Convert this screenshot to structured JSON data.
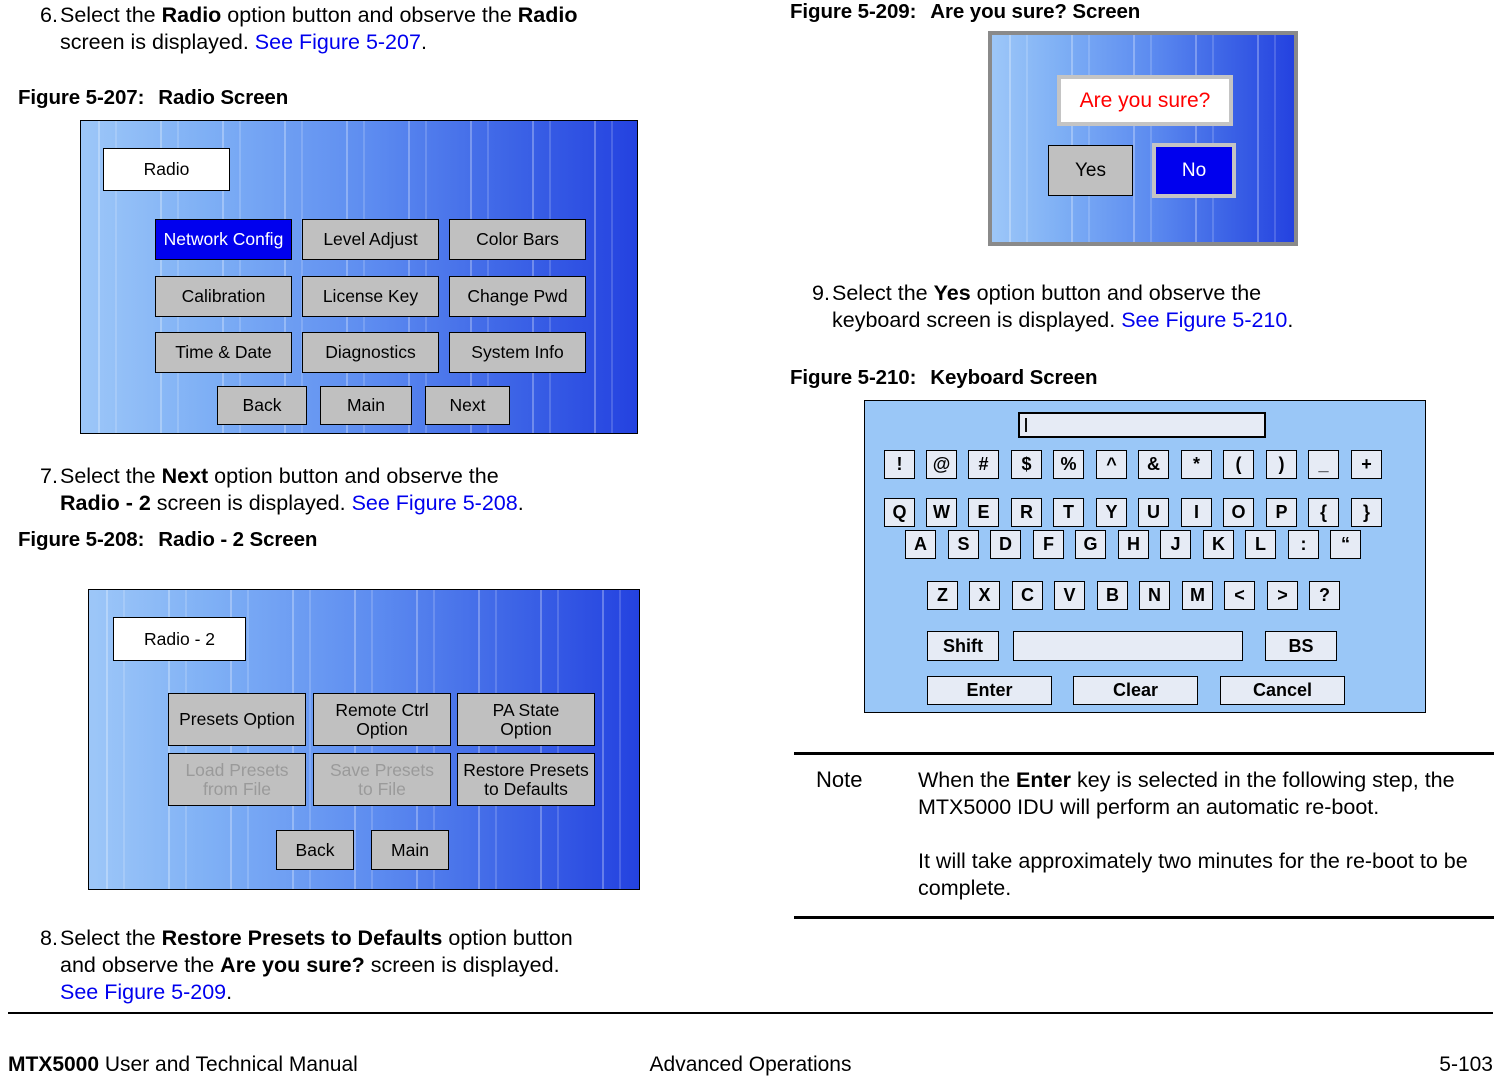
{
  "steps": {
    "s6": {
      "num": "6.",
      "l1_a": "Select the ",
      "l1_b": "Radio",
      "l1_c": " option button and observe the ",
      "l1_d": "Radio",
      "l2_a": "screen is displayed.  ",
      "l2_link": "See Figure 5-207",
      "l2_b": "."
    },
    "s7": {
      "num": "7.",
      "l1_a": "Select the ",
      "l1_b": "Next",
      "l1_c": " option button and observe the",
      "l2_a": "Radio - 2",
      "l2_b": " screen is displayed.  ",
      "l2_link": "See Figure 5-208",
      "l2_c": "."
    },
    "s8": {
      "num": "8.",
      "l1_a": "Select the ",
      "l1_b": "Restore Presets to Defaults",
      "l1_c": " option button",
      "l2_a": "and observe the ",
      "l2_b": "Are you sure?",
      "l2_c": " screen is displayed.",
      "l3_link": "See Figure 5-209",
      "l3_b": "."
    },
    "s9": {
      "num": "9.",
      "l1_a": "Select the ",
      "l1_b": "Yes",
      "l1_c": " option button and observe the",
      "l2_a": "keyboard screen is displayed.  ",
      "l2_link": "See Figure 5-210",
      "l2_b": "."
    }
  },
  "figures": {
    "f207": {
      "number": "Figure 5-207:",
      "title": "Radio Screen"
    },
    "f208": {
      "number": "Figure 5-208:",
      "title": "Radio - 2 Screen"
    },
    "f209": {
      "number": "Figure 5-209:",
      "title": "Are you sure? Screen"
    },
    "f210": {
      "number": "Figure 5-210:",
      "title": "Keyboard Screen"
    }
  },
  "radio_screen": {
    "title": "Radio",
    "buttons": [
      {
        "label": "Network Config",
        "state": "selected"
      },
      {
        "label": "Level Adjust",
        "state": "normal"
      },
      {
        "label": "Color Bars",
        "state": "normal"
      },
      {
        "label": "Calibration",
        "state": "normal"
      },
      {
        "label": "License Key",
        "state": "normal"
      },
      {
        "label": "Change Pwd",
        "state": "normal"
      },
      {
        "label": "Time & Date",
        "state": "normal"
      },
      {
        "label": "Diagnostics",
        "state": "normal"
      },
      {
        "label": "System Info",
        "state": "normal"
      }
    ],
    "nav": [
      {
        "label": "Back"
      },
      {
        "label": "Main"
      },
      {
        "label": "Next"
      }
    ]
  },
  "radio2_screen": {
    "title": "Radio - 2",
    "buttons": [
      {
        "label": "Presets Option",
        "state": "normal"
      },
      {
        "label": "Remote Ctrl\nOption",
        "state": "normal"
      },
      {
        "label": "PA State\nOption",
        "state": "normal"
      },
      {
        "label": "Load Presets\nfrom File",
        "state": "disabled"
      },
      {
        "label": "Save Presets\nto File",
        "state": "disabled"
      },
      {
        "label": "Restore Presets\nto Defaults",
        "state": "normal"
      }
    ],
    "nav": [
      {
        "label": "Back"
      },
      {
        "label": "Main"
      }
    ]
  },
  "confirm_screen": {
    "message": "Are you sure?",
    "message_color": "#ff0000",
    "yes_label": "Yes",
    "no_label": "No",
    "no_state": "selected"
  },
  "keyboard_screen": {
    "field_value": "",
    "rows": [
      {
        "keys": [
          "!",
          "@",
          "#",
          "$",
          "%",
          "^",
          "&",
          "*",
          "(",
          ")",
          "_",
          "+"
        ]
      },
      {
        "keys": [
          "Q",
          "W",
          "E",
          "R",
          "T",
          "Y",
          "U",
          "I",
          "O",
          "P",
          "{",
          "}"
        ]
      },
      {
        "keys": [
          "A",
          "S",
          "D",
          "F",
          "G",
          "H",
          "J",
          "K",
          "L",
          ":",
          "“"
        ]
      },
      {
        "keys": [
          "Z",
          "X",
          "C",
          "V",
          "B",
          "N",
          "M",
          "<",
          ">",
          "?"
        ]
      }
    ],
    "shift_label": "Shift",
    "space_label": "",
    "bs_label": "BS",
    "enter_label": "Enter",
    "clear_label": "Clear",
    "cancel_label": "Cancel"
  },
  "note": {
    "label": "Note",
    "p1_a": "When the ",
    "p1_b": "Enter",
    "p1_c": " key is selected in the following step, the MTX5000 IDU will perform an automatic re-boot.",
    "p2": "It will take approximately two minutes for the re-boot to be complete."
  },
  "footer": {
    "manual_bold": "MTX5000",
    "manual_rest": " User and Technical Manual",
    "section": "Advanced Operations",
    "page": "5-103"
  }
}
